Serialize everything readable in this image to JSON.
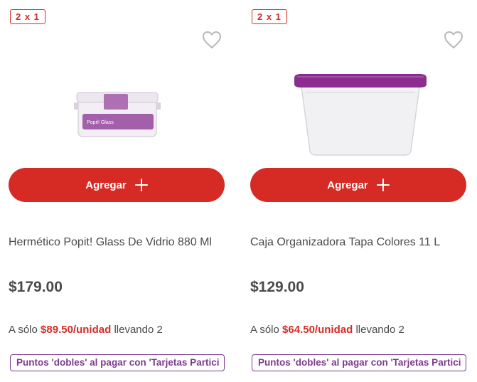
{
  "products": [
    {
      "badge": "2 x 1",
      "add_label": "Agregar",
      "name": "Hermético Popit! Glass De Vidrio 880 Ml",
      "price": "$179.00",
      "promo_prefix": "A sólo",
      "promo_price": "$89.50/unidad",
      "promo_suffix": "llevando 2",
      "points_label": "Puntos 'dobles' al pagar con 'Tarjetas Partici",
      "image_label_text": "Popit! Glass"
    },
    {
      "badge": "2 x 1",
      "add_label": "Agregar",
      "name": "Caja Organizadora Tapa Colores 11 L",
      "price": "$129.00",
      "promo_prefix": "A sólo",
      "promo_price": "$64.50/unidad",
      "promo_suffix": "llevando 2",
      "points_label": "Puntos 'dobles' al pagar con 'Tarjetas Partici"
    }
  ],
  "colors": {
    "accent_red": "#d62b24",
    "points_purple": "#7c3a8e",
    "text_gray": "#4a4a4a",
    "lid_purple": "#8b2d8f"
  },
  "icons": {
    "favorite": "heart-outline-icon",
    "add": "plus-icon"
  }
}
